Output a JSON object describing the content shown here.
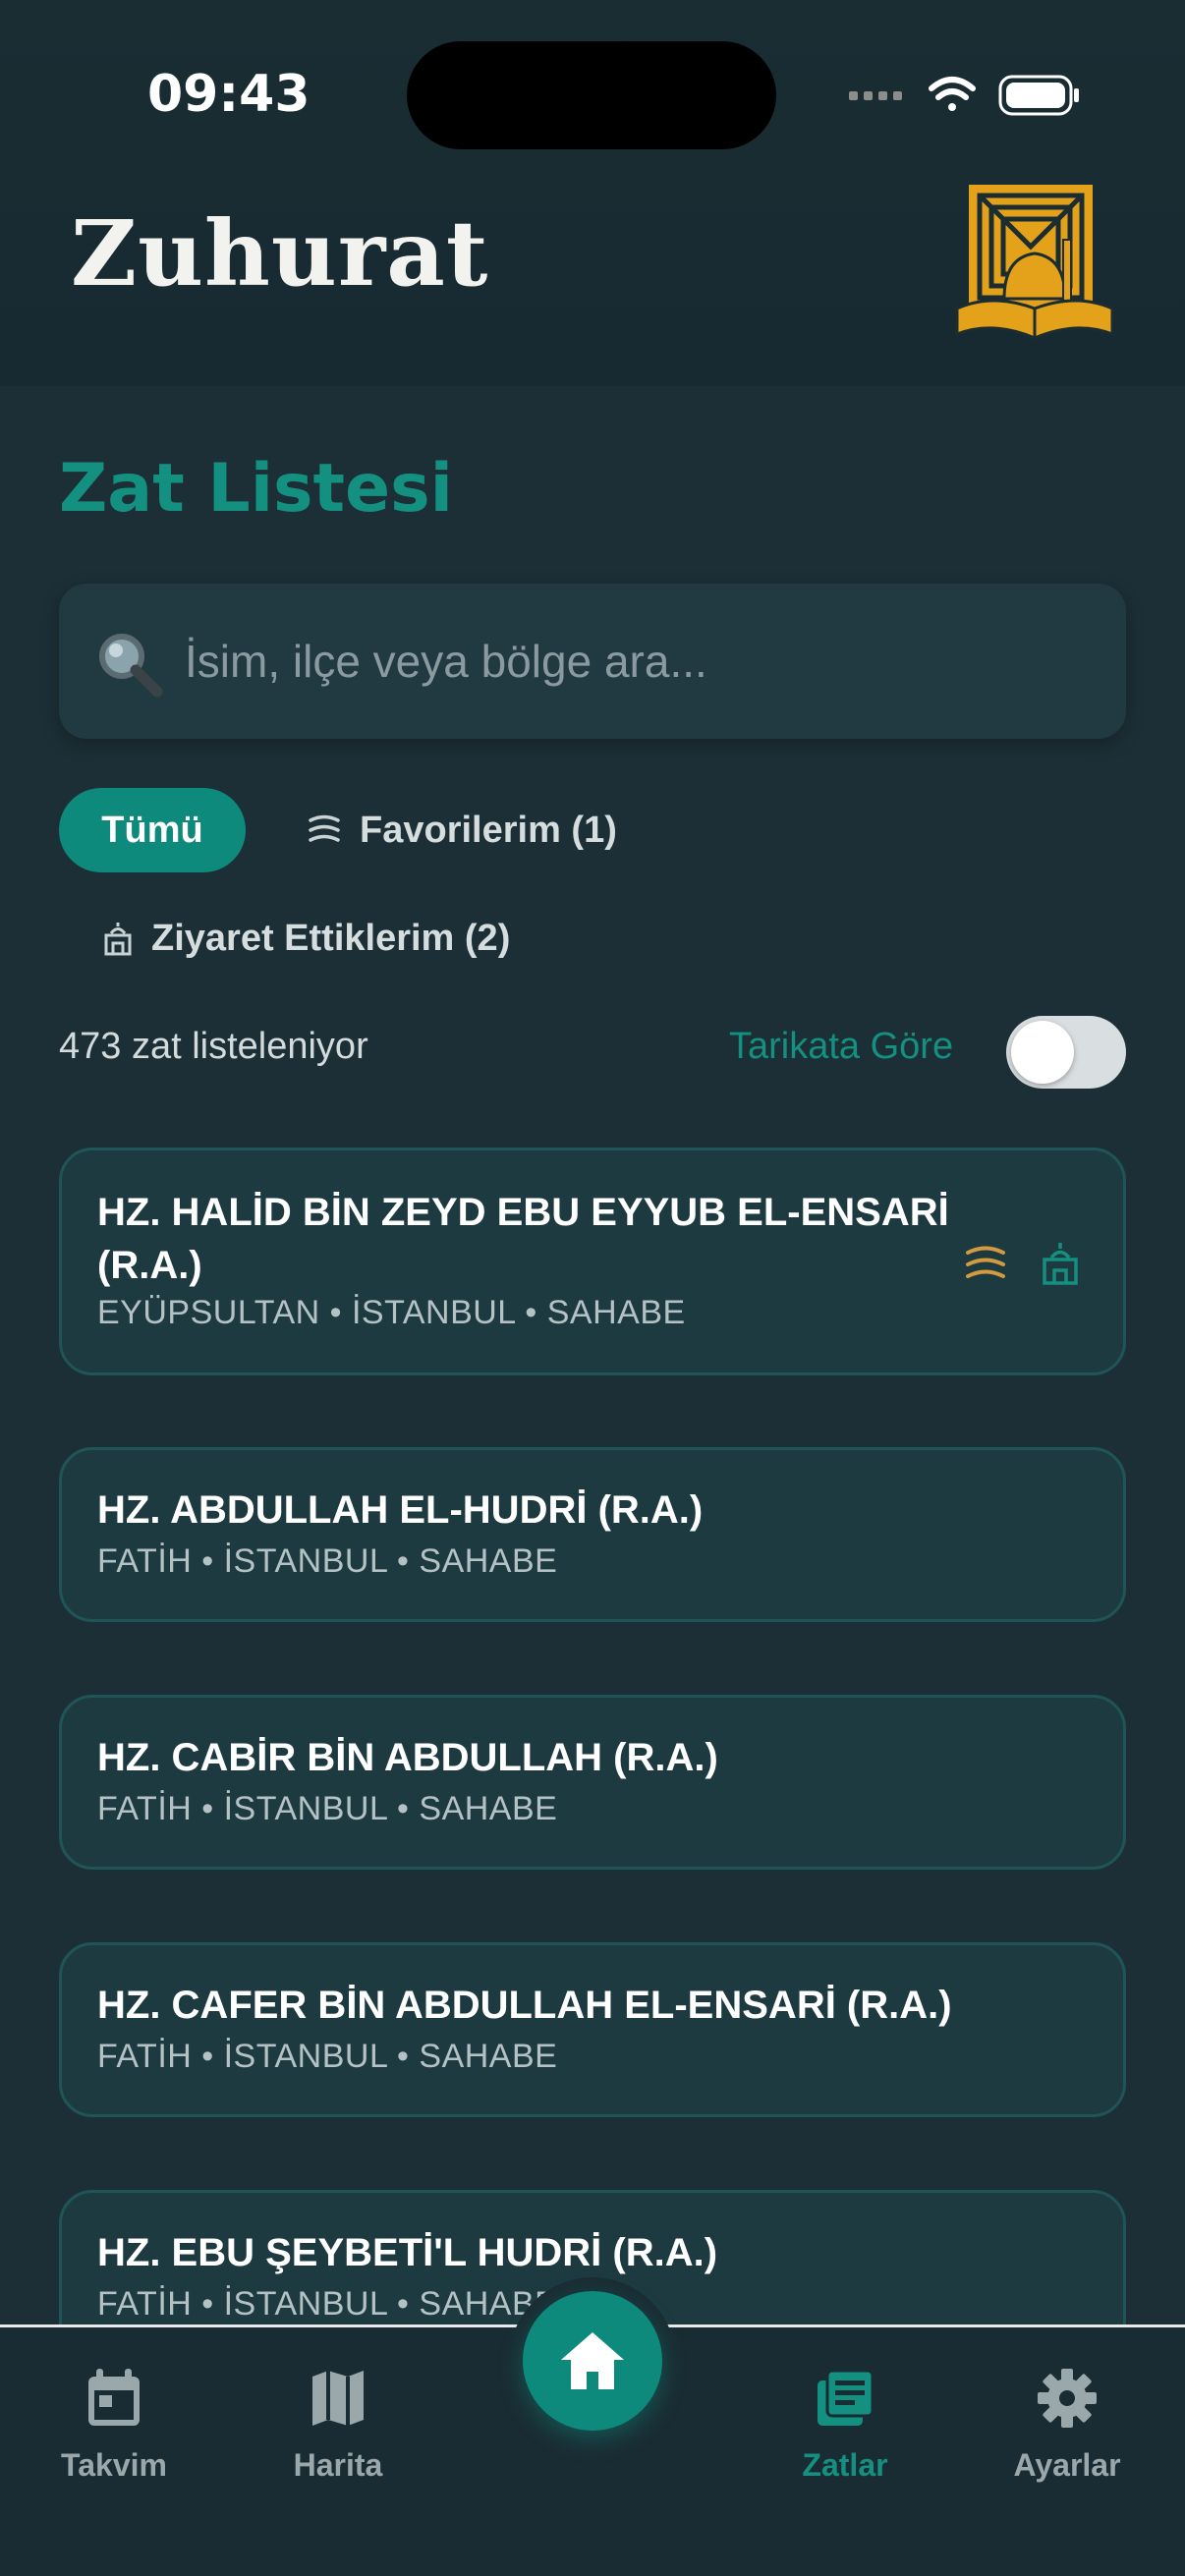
{
  "status_bar": {
    "time": "09:43"
  },
  "header": {
    "app_title": "Zuhurat",
    "logo_icon": "mosque-book-logo"
  },
  "page": {
    "title": "Zat Listesi"
  },
  "search": {
    "placeholder": "İsim, ilçe veya bölge ara...",
    "value": ""
  },
  "filters": {
    "all_label": "Tümü",
    "favorites_label": "Favorilerim (1)",
    "visited_label": "Ziyaret Ettiklerim (2)"
  },
  "summary": {
    "count_text": "473 zat listeleniyor",
    "tarikat_label": "Tarikata Göre",
    "tarikat_toggle_on": false
  },
  "list": [
    {
      "name": "HZ. HALİD BİN ZEYD EBU EYYUB EL-ENSARİ (R.A.)",
      "sub": "EYÜPSULTAN • İSTANBUL • SAHABE",
      "favorite": true,
      "visited": true
    },
    {
      "name": "HZ. ABDULLAH EL-HUDRİ (R.A.)",
      "sub": "FATİH • İSTANBUL • SAHABE"
    },
    {
      "name": "HZ. CABİR BİN ABDULLAH (R.A.)",
      "sub": "FATİH • İSTANBUL • SAHABE"
    },
    {
      "name": "HZ. CAFER BİN ABDULLAH EL-ENSARİ (R.A.)",
      "sub": "FATİH • İSTANBUL • SAHABE"
    },
    {
      "name": "HZ. EBU ŞEYBETİ'L HUDRİ (R.A.)",
      "sub": "FATİH • İSTANBUL • SAHABE"
    }
  ],
  "nav": {
    "calendar_label": "Takvim",
    "map_label": "Harita",
    "home_icon": "home-icon",
    "zatlar_label": "Zatlar",
    "settings_label": "Ayarlar",
    "active": "Zatlar"
  },
  "colors": {
    "accent": "#149080",
    "gold": "#e3a21a",
    "background": "#1c2f36",
    "card": "#1d3a41"
  }
}
